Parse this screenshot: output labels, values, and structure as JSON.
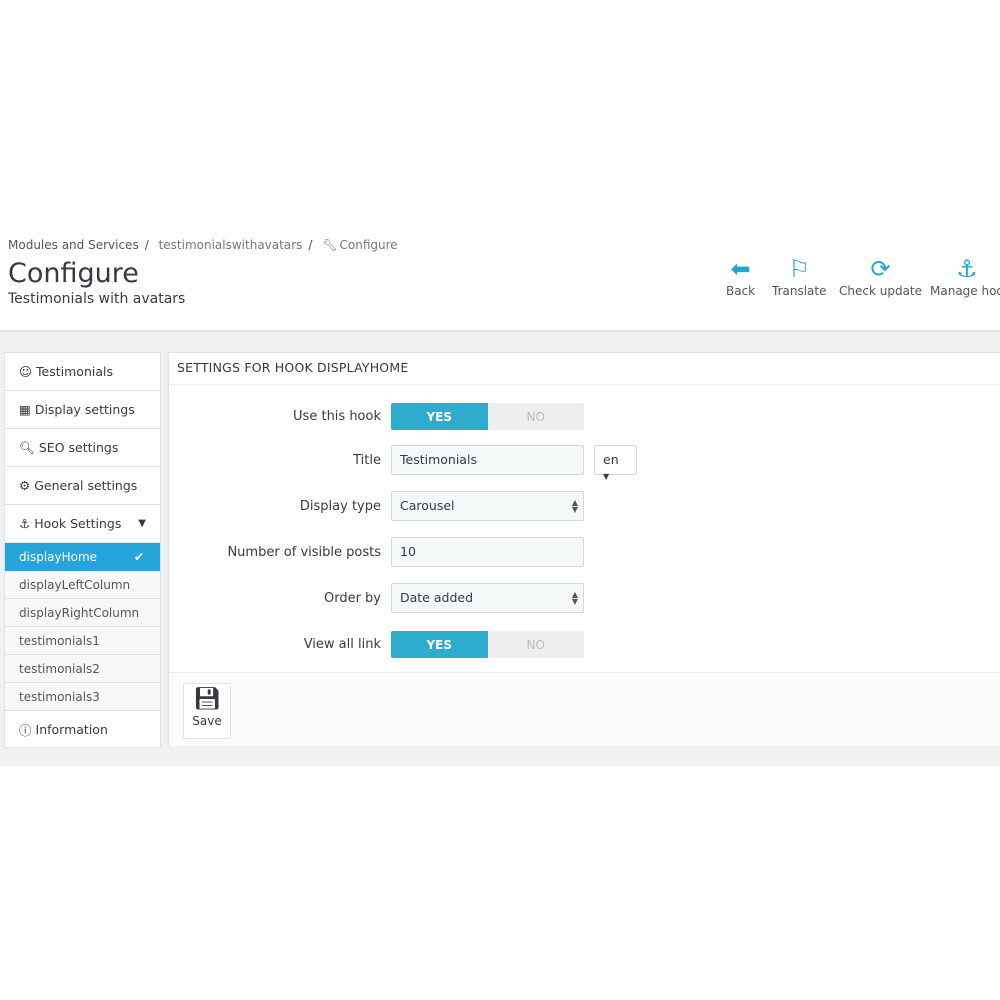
{
  "breadcrumb": [
    "Modules and Services",
    "testimonialswithavatars",
    "Configure"
  ],
  "header": {
    "title": "Configure",
    "subtitle": "Testimonials with avatars"
  },
  "toolbar": [
    {
      "label": "Back",
      "icon": "back-circle-icon"
    },
    {
      "label": "Translate",
      "icon": "flag-icon"
    },
    {
      "label": "Check update",
      "icon": "refresh-icon"
    },
    {
      "label": "Manage hoo",
      "icon": "anchor-icon"
    }
  ],
  "sidebar": {
    "items": [
      "Testimonials",
      "Display settings",
      "SEO settings",
      "General settings",
      "Hook Settings"
    ],
    "hooks": [
      "displayHome",
      "displayLeftColumn",
      "displayRightColumn",
      "testimonials1",
      "testimonials2",
      "testimonials3"
    ],
    "info": "Information",
    "active_color": "#25a5dc"
  },
  "panel": {
    "heading": "SETTINGS FOR HOOK DISPLAYHOME",
    "fields": {
      "use_hook": {
        "label": "Use this hook",
        "yes": "YES",
        "no": "NO",
        "value": "YES"
      },
      "title": {
        "label": "Title",
        "value": "Testimonials",
        "lang": "en"
      },
      "display_type": {
        "label": "Display type",
        "value": "Carousel"
      },
      "visible_posts": {
        "label": "Number of visible posts",
        "value": "10"
      },
      "order_by": {
        "label": "Order by",
        "value": "Date added"
      },
      "view_all": {
        "label": "View all link",
        "yes": "YES",
        "no": "NO",
        "value": "YES"
      }
    },
    "save": "Save"
  }
}
